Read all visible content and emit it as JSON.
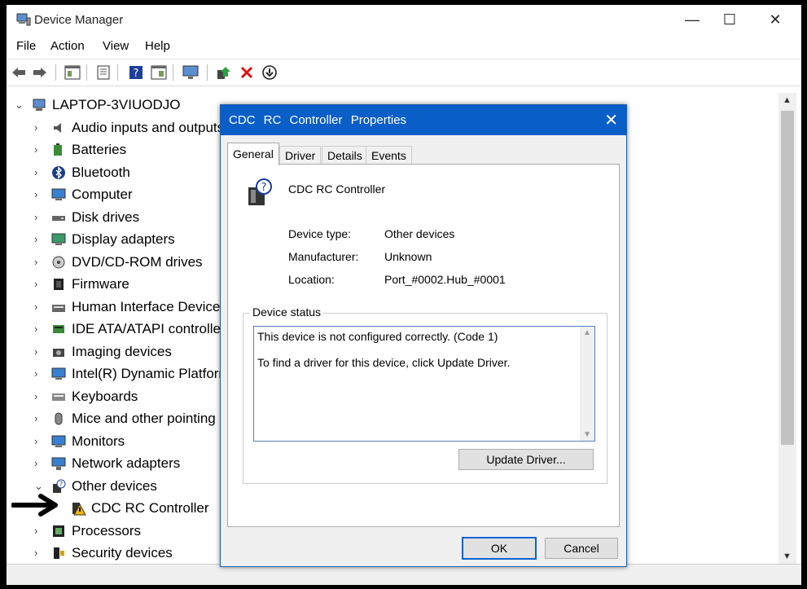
{
  "window": {
    "title": "Device Manager",
    "minimize_glyph": "—",
    "maximize_glyph": "☐",
    "close_glyph": "✕"
  },
  "menu": [
    "File",
    "Action",
    "View",
    "Help"
  ],
  "toolbar_icons": [
    "back-icon",
    "forward-icon",
    "properties-icon",
    "update-driver-icon",
    "help-icon",
    "show-hidden-icon",
    "scan-hardware-icon",
    "add-driver-icon",
    "uninstall-icon",
    "download-icon"
  ],
  "tree": {
    "root": "LAPTOP-3VIUODJO",
    "items": [
      {
        "label": "Audio inputs and outputs",
        "icon": "speaker-icon",
        "expanded": false
      },
      {
        "label": "Batteries",
        "icon": "battery-icon",
        "expanded": false
      },
      {
        "label": "Bluetooth",
        "icon": "bluetooth-icon",
        "expanded": false
      },
      {
        "label": "Computer",
        "icon": "computer-icon",
        "expanded": false
      },
      {
        "label": "Disk drives",
        "icon": "disk-icon",
        "expanded": false
      },
      {
        "label": "Display adapters",
        "icon": "display-icon",
        "expanded": false
      },
      {
        "label": "DVD/CD-ROM drives",
        "icon": "dvd-icon",
        "expanded": false
      },
      {
        "label": "Firmware",
        "icon": "chip-icon",
        "expanded": false
      },
      {
        "label": "Human Interface Devices",
        "icon": "hid-icon",
        "expanded": false
      },
      {
        "label": "IDE ATA/ATAPI controllers",
        "icon": "ide-icon",
        "expanded": false
      },
      {
        "label": "Imaging devices",
        "icon": "camera-icon",
        "expanded": false
      },
      {
        "label": "Intel(R) Dynamic Platform",
        "icon": "monitor-icon",
        "expanded": false
      },
      {
        "label": "Keyboards",
        "icon": "keyboard-icon",
        "expanded": false
      },
      {
        "label": "Mice and other pointing devices",
        "icon": "mouse-icon",
        "expanded": false
      },
      {
        "label": "Monitors",
        "icon": "monitor-icon",
        "expanded": false
      },
      {
        "label": "Network adapters",
        "icon": "network-icon",
        "expanded": false
      },
      {
        "label": "Other devices",
        "icon": "unknown-device-icon",
        "expanded": true
      },
      {
        "label": "CDC RC Controller",
        "icon": "warning-device-icon",
        "child": true
      },
      {
        "label": "Processors",
        "icon": "processor-icon",
        "expanded": false
      },
      {
        "label": "Security devices",
        "icon": "security-icon",
        "expanded": false
      }
    ]
  },
  "dialog": {
    "title": "CDC RC Controller Properties",
    "close_glyph": "✕",
    "tabs": [
      "General",
      "Driver",
      "Details",
      "Events"
    ],
    "device_name": "CDC RC Controller",
    "fields": [
      {
        "label": "Device type:",
        "value": "Other devices"
      },
      {
        "label": "Manufacturer:",
        "value": "Unknown"
      },
      {
        "label": "Location:",
        "value": "Port_#0002.Hub_#0001"
      }
    ],
    "status_group": "Device status",
    "status_line1": "This device is not configured correctly. (Code 1)",
    "status_line2": "To find a driver for this device, click Update Driver.",
    "update_button": "Update Driver...",
    "ok_button": "OK",
    "cancel_button": "Cancel"
  },
  "colors": {
    "dialog_title": "#0a5ec8",
    "warning": "#f2b705",
    "arrow": "#000000"
  }
}
